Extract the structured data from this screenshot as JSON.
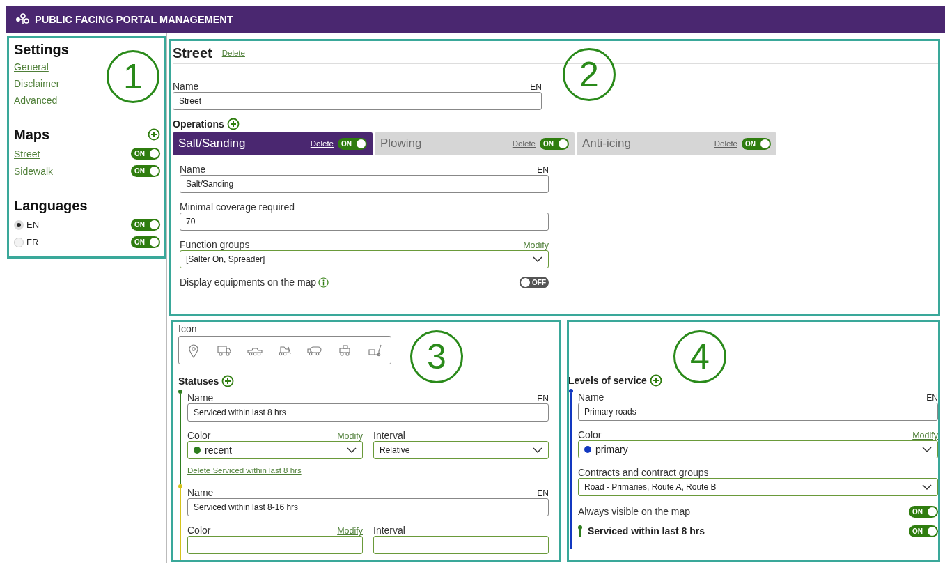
{
  "header": {
    "title": "PUBLIC FACING PORTAL MANAGEMENT"
  },
  "sidebar": {
    "callout": "1",
    "settings": {
      "title": "Settings",
      "links": [
        "General",
        "Disclaimer",
        "Advanced"
      ]
    },
    "maps": {
      "title": "Maps",
      "items": [
        {
          "label": "Street",
          "toggle": {
            "on": true,
            "text": "ON"
          }
        },
        {
          "label": "Sidewalk",
          "toggle": {
            "on": true,
            "text": "ON"
          }
        }
      ]
    },
    "languages": {
      "title": "Languages",
      "items": [
        {
          "label": "EN",
          "selected": true,
          "toggle": {
            "on": true,
            "text": "ON"
          }
        },
        {
          "label": "FR",
          "selected": false,
          "toggle": {
            "on": true,
            "text": "ON"
          }
        }
      ]
    }
  },
  "map_editor": {
    "callout": "2",
    "title": "Street",
    "delete": "Delete",
    "name_field": {
      "label": "Name",
      "lang": "EN",
      "value": "Street"
    },
    "operations": {
      "title": "Operations",
      "tabs": [
        {
          "label": "Salt/Sanding",
          "selected": true,
          "delete": "Delete",
          "toggle": {
            "on": true,
            "text": "ON"
          }
        },
        {
          "label": "Plowing",
          "selected": false,
          "delete": "Delete",
          "toggle": {
            "on": true,
            "text": "ON"
          }
        },
        {
          "label": "Anti-icing",
          "selected": false,
          "delete": "Delete",
          "toggle": {
            "on": true,
            "text": "ON"
          }
        }
      ],
      "panel": {
        "name_field": {
          "label": "Name",
          "lang": "EN",
          "value": "Salt/Sanding"
        },
        "coverage": {
          "label": "Minimal coverage required",
          "value": "70"
        },
        "function_groups": {
          "label": "Function groups",
          "action": "Modify",
          "value": "[Salter On, Spreader]"
        },
        "display_equipments": {
          "label": "Display equipments on the map",
          "toggle": {
            "on": false,
            "text": "OFF"
          }
        }
      }
    }
  },
  "icon_section": {
    "callout": "3",
    "label": "Icon",
    "statuses": {
      "title": "Statuses",
      "items": [
        {
          "color": "#2e7d1e",
          "name_label": "Name",
          "lang": "EN",
          "value": "Serviced within last 8 hrs",
          "color_label": "Color",
          "modify": "Modify",
          "color_value": "recent",
          "interval_label": "Interval",
          "interval_value": "Relative",
          "delete_link": "Delete Serviced within last 8 hrs"
        },
        {
          "color": "#d4c21a",
          "name_label": "Name",
          "lang": "EN",
          "value": "Serviced within last 8-16 hrs",
          "color_label": "Color",
          "modify": "Modify",
          "interval_label": "Interval"
        }
      ]
    }
  },
  "levels": {
    "callout": "4",
    "title": "Levels of service",
    "items": [
      {
        "color": "#1238c0",
        "name_label": "Name",
        "lang": "EN",
        "value": "Primary roads",
        "color_label": "Color",
        "modify": "Modify",
        "color_value": "primary",
        "contracts_label": "Contracts and contract groups",
        "contracts_value": "Road - Primaries, Route A, Route B",
        "visible_label": "Always visible on the map",
        "visible_toggle": {
          "on": true,
          "text": "ON"
        },
        "statuses": [
          {
            "label": "Serviced within last 8 hrs",
            "color": "#2e7d1e",
            "toggle": {
              "on": true,
              "text": "ON"
            }
          }
        ]
      }
    ]
  }
}
